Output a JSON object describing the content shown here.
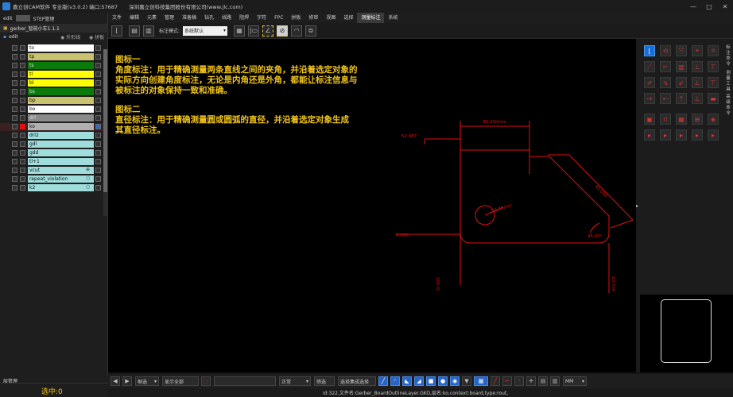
{
  "app": {
    "title": "嘉立创CAM软件 专业版(v3.0.2) 端口:57687",
    "company": "深圳嘉立创科技集团股份有限公司(www.jlc.com)"
  },
  "window_controls": [
    "—",
    "□",
    "✕"
  ],
  "menu": [
    "文件",
    "编辑",
    "元素",
    "管理",
    "准备稿",
    "钻孔",
    "线路",
    "阻焊",
    "字符",
    "FPC",
    "拼板",
    "修审",
    "视图",
    "选择",
    "测量标注",
    "系统"
  ],
  "menu_active": "测量标注",
  "toolbar": {
    "mode_label": "标注模式:",
    "mode_value": "系统默认"
  },
  "left": {
    "tabs": [
      "edit",
      "STEP管理"
    ],
    "job": "gerber_智能小车1.1.1",
    "step": "edit",
    "opts": [
      "外形线",
      "拼板"
    ],
    "layers": [
      {
        "name": "to",
        "color": "#ffffff"
      },
      {
        "name": "tp",
        "color": "#c9c26e"
      },
      {
        "name": "ts",
        "color": "#0a7a0a"
      },
      {
        "name": "tl",
        "color": "#ffff00"
      },
      {
        "name": "bl",
        "color": "#ffff00"
      },
      {
        "name": "bs",
        "color": "#0a7a0a"
      },
      {
        "name": "bp",
        "color": "#c9c26e"
      },
      {
        "name": "bo",
        "color": "#ffffff"
      },
      {
        "name": "drl",
        "color": "#8a8a8a"
      },
      {
        "name": "ko",
        "color": "#b0b0b0",
        "selected": true
      },
      {
        "name": "drl2",
        "color": "#9fdcdc"
      },
      {
        "name": "gdl",
        "color": "#9fdcdc"
      },
      {
        "name": "gdd",
        "color": "#9fdcdc"
      },
      {
        "name": "tl+1",
        "color": "#9fdcdc"
      },
      {
        "name": "vcut",
        "color": "#9fdcdc",
        "icon": "⊕"
      },
      {
        "name": "repeat_violation",
        "color": "#9fdcdc",
        "icon": "○"
      },
      {
        "name": "k2",
        "color": "#9fdcdc",
        "icon": "○"
      }
    ],
    "layer_mgr": "层管理",
    "selected_count": "选中:0"
  },
  "notes": {
    "n1_title": "图标一",
    "n1_l1": "角度标注：用于精确测量两条直线之间的夹角，并沿着选定对象的",
    "n1_l2": "实际方向创建角度标注，无论是内角还是外角，都能让标注信息与",
    "n1_l3": "被标注的对象保持一致和准确。",
    "n2_title": "图标二",
    "n2_l1": "直径标注：用于精确测量圆或圆弧的直径，并沿着选定对象生成",
    "n2_l2": "其直径标注。"
  },
  "dims": {
    "top": "30.250mm",
    "left": "52.487",
    "diag": "40.000",
    "diam": "12.75mm",
    "angle": "45.00°",
    "x0": "0.000",
    "y0": "-0.000",
    "right": "20.700"
  },
  "right_labels": [
    "标注命令",
    "测量工具",
    "高级命令"
  ],
  "bottom": {
    "mode": "框选",
    "btn1": "显示全部",
    "normal": "正常",
    "filter": "筛选",
    "select_all": "选择集成选择",
    "unit": "MM"
  },
  "status": "id:322,文件名:Gerber_BoardOutlineLayer.GKO,层名:ko,context:board,type:rout,"
}
